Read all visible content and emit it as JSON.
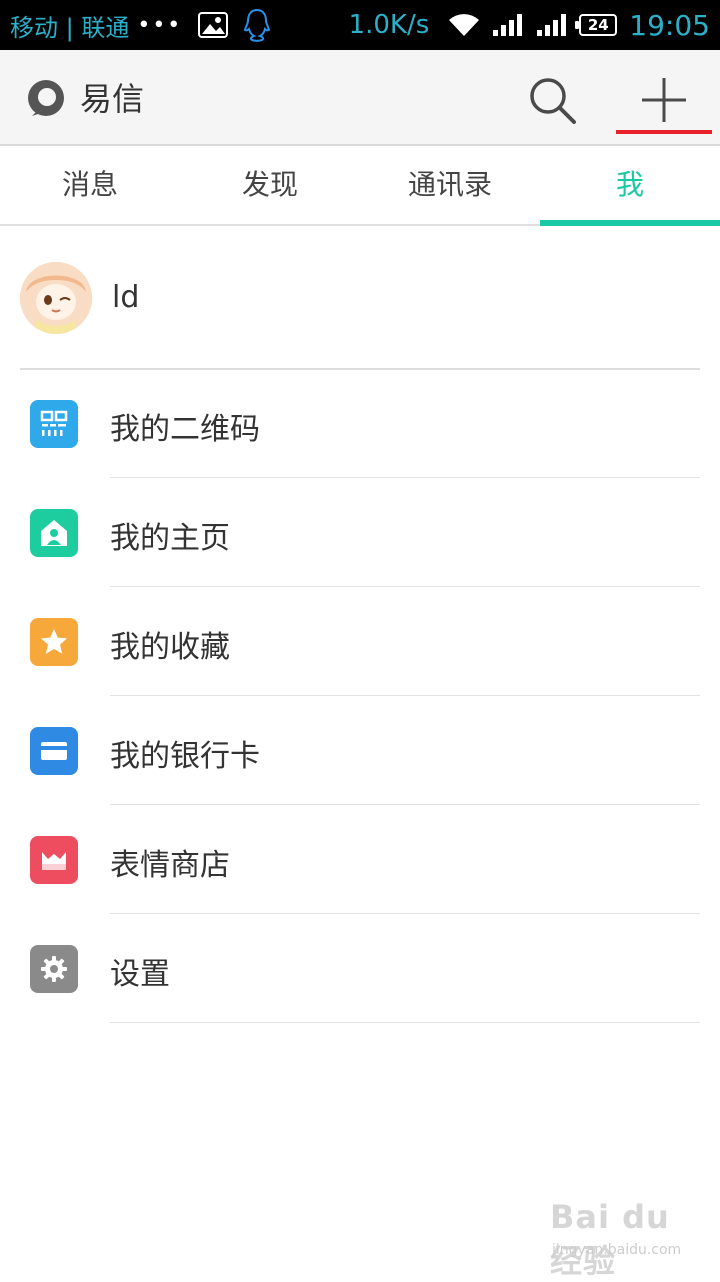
{
  "status_bar": {
    "carrier": "移动 | 联通",
    "dots": "•••",
    "speed": "1.0K/s",
    "battery": "24",
    "time": "19:05",
    "color": "#2ab0c9"
  },
  "header": {
    "title": "易信",
    "search_icon": "search-icon",
    "add_icon": "plus-icon"
  },
  "tabs": [
    {
      "label": "消息",
      "active": false
    },
    {
      "label": "发现",
      "active": false
    },
    {
      "label": "通讯录",
      "active": false
    },
    {
      "label": "我",
      "active": true
    }
  ],
  "profile": {
    "name": "ld"
  },
  "menu": [
    {
      "label": "我的二维码",
      "icon": "qrcode-icon",
      "color": "#2fa9ea"
    },
    {
      "label": "我的主页",
      "icon": "home-icon",
      "color": "#1dcc9f"
    },
    {
      "label": "我的收藏",
      "icon": "star-icon",
      "color": "#f7a83a"
    },
    {
      "label": "我的银行卡",
      "icon": "card-icon",
      "color": "#2f8ae3"
    },
    {
      "label": "表情商店",
      "icon": "store-icon",
      "color": "#ee4d5f"
    },
    {
      "label": "设置",
      "icon": "gear-icon",
      "color": "#8a8a8a"
    }
  ],
  "colors": {
    "accent": "#19c8a4",
    "highlight": "#e8202a"
  },
  "watermark": {
    "brand": "Bai du 经验",
    "url": "jingyan.baidu.com"
  }
}
